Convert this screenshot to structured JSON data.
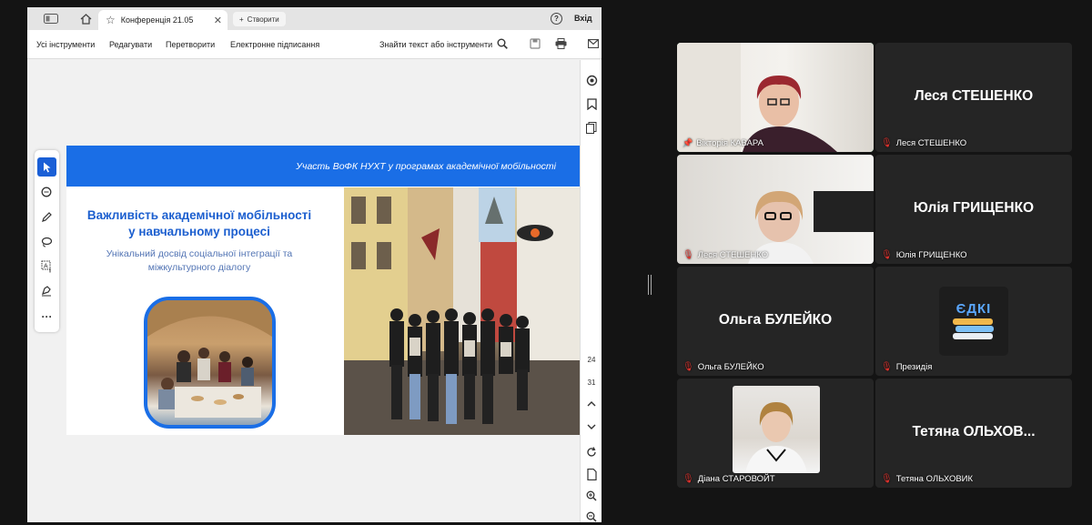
{
  "viewer": {
    "tab_title": "Конференція 21.05",
    "create_label": "Створити",
    "help_label": "?",
    "signin_label": "Вхід",
    "menu": [
      "Усі інструменти",
      "Редагувати",
      "Перетворити",
      "Електронне підписання"
    ],
    "find_tools": "Знайти текст або інструменти",
    "page_current": "24",
    "page_total": "31"
  },
  "slide": {
    "header": "Участь ВоФК НУХТ у програмах академічної мобільності",
    "title": "Важливість академічної мобільності у навчальному процесі",
    "subtitle": "Унікальний досвід соціальної інтеграції та міжкультурного діалогу"
  },
  "participants": [
    {
      "label": "Вікторія КАВАРА",
      "big_name": "",
      "muted": false,
      "pinned": true,
      "speaking": true,
      "video": true
    },
    {
      "label": "Леся СТЕШЕНКО",
      "big_name": "Леся СТЕШЕНКО",
      "muted": true,
      "pinned": false,
      "speaking": false,
      "video": false
    },
    {
      "label": "Леся СТЕШЕНКО",
      "big_name": "",
      "muted": true,
      "pinned": false,
      "speaking": false,
      "video": true
    },
    {
      "label": "Юлія ГРИЩЕНКО",
      "big_name": "Юлія ГРИЩЕНКО",
      "muted": true,
      "pinned": false,
      "speaking": false,
      "video": false
    },
    {
      "label": "Ольга БУЛЕЙКО",
      "big_name": "Ольга БУЛЕЙКО",
      "muted": true,
      "pinned": false,
      "speaking": false,
      "video": false
    },
    {
      "label": "Президія",
      "big_name": "",
      "muted": true,
      "pinned": false,
      "speaking": false,
      "video": false,
      "logo": "ЄДКІ"
    },
    {
      "label": "Діана СТАРОВОЙТ",
      "big_name": "",
      "muted": true,
      "pinned": false,
      "speaking": false,
      "video": false
    },
    {
      "label": "Тетяна ОЛЬХОВИК",
      "big_name": "Тетяна  ОЛЬХОВ...",
      "muted": true,
      "pinned": false,
      "speaking": false,
      "video": false
    }
  ],
  "colors": {
    "accent_blue": "#1a6ee6",
    "speaking_border": "#3dd98b",
    "mic_off": "#e0322d"
  }
}
